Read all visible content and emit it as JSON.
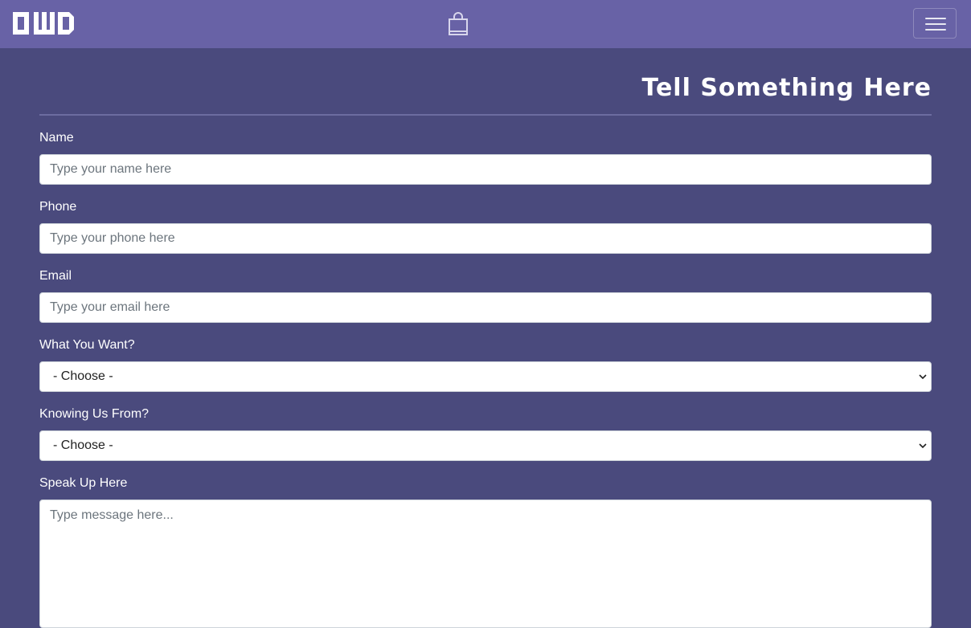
{
  "navbar": {
    "logo_text": "OWD",
    "cart_icon": "shopping-bag-icon",
    "menu_icon": "hamburger-menu-icon",
    "background": "#6862a6"
  },
  "page": {
    "background": "#4a4a7d",
    "title": "Tell Something Here"
  },
  "form": {
    "name": {
      "label": "Name",
      "placeholder": "Type your name here"
    },
    "phone": {
      "label": "Phone",
      "placeholder": "Type your phone here"
    },
    "email": {
      "label": "Email",
      "placeholder": "Type your email here"
    },
    "want": {
      "label": "What You Want?",
      "selected": "- Choose -"
    },
    "source": {
      "label": "Knowing Us From?",
      "selected": "- Choose -"
    },
    "message": {
      "label": "Speak Up Here",
      "placeholder": "Type message here..."
    }
  }
}
